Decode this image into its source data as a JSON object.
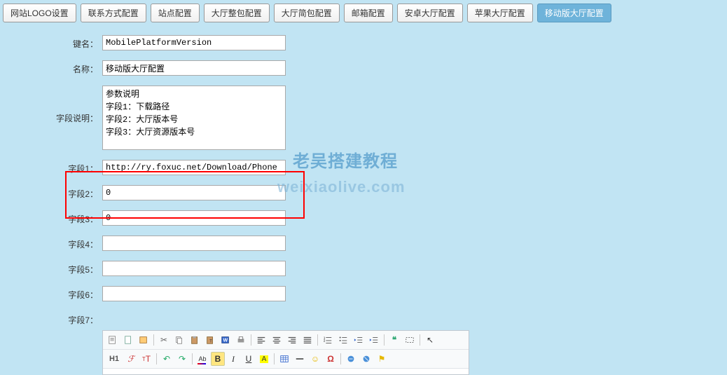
{
  "tabs": [
    {
      "label": "网站LOGO设置",
      "active": false
    },
    {
      "label": "联系方式配置",
      "active": false
    },
    {
      "label": "站点配置",
      "active": false
    },
    {
      "label": "大厅整包配置",
      "active": false
    },
    {
      "label": "大厅简包配置",
      "active": false
    },
    {
      "label": "邮箱配置",
      "active": false
    },
    {
      "label": "安卓大厅配置",
      "active": false
    },
    {
      "label": "苹果大厅配置",
      "active": false
    },
    {
      "label": "移动版大厅配置",
      "active": true
    }
  ],
  "form": {
    "key_label": "键名：",
    "key_value": "MobilePlatformVersion",
    "name_label": "名称：",
    "name_value": "移动版大厅配置",
    "desc_label": "字段说明：",
    "desc_value": "参数说明\n字段1：下载路径\n字段2：大厅版本号\n字段3：大厅资源版本号",
    "f1_label": "字段1：",
    "f1_value": "http://ry.foxuc.net/Download/Phone",
    "f2_label": "字段2：",
    "f2_value": "0",
    "f3_label": "字段3：",
    "f3_value": "0",
    "f4_label": "字段4：",
    "f4_value": "",
    "f5_label": "字段5：",
    "f5_value": "",
    "f6_label": "字段6：",
    "f6_value": "",
    "f7_label": "字段7："
  },
  "watermark": {
    "line1": "老吴搭建教程",
    "line2": "weixiaolive.com"
  },
  "editor_icons": {
    "source": "📄",
    "newdoc": "📄",
    "template": "📋",
    "cut": "✂",
    "copy": "📋",
    "paste": "📋",
    "paste_text": "📋",
    "paste_word": "W",
    "print": "🖨",
    "find": "🔍",
    "selectall": "☐",
    "removefmt": "Tx",
    "al": "≡",
    "ac": "≡",
    "ar": "≡",
    "aj": "≡",
    "ol": "≡",
    "ul": "≡",
    "outdent": "⇤",
    "indent": "⇥",
    "quote": "❝",
    "div": "▭",
    "h1": "H1",
    "fontf": "ℱ",
    "undo": "↶",
    "redo": "↷",
    "color": "Ab",
    "bold": "B",
    "italic": "I",
    "underline": "U",
    "bg": "A",
    "table": "▦",
    "hr": "—",
    "smile": "☺",
    "special": "Ω",
    "link": "🔗",
    "unlink": "⛓",
    "anchor": "⚓",
    "cursor": "↖"
  }
}
